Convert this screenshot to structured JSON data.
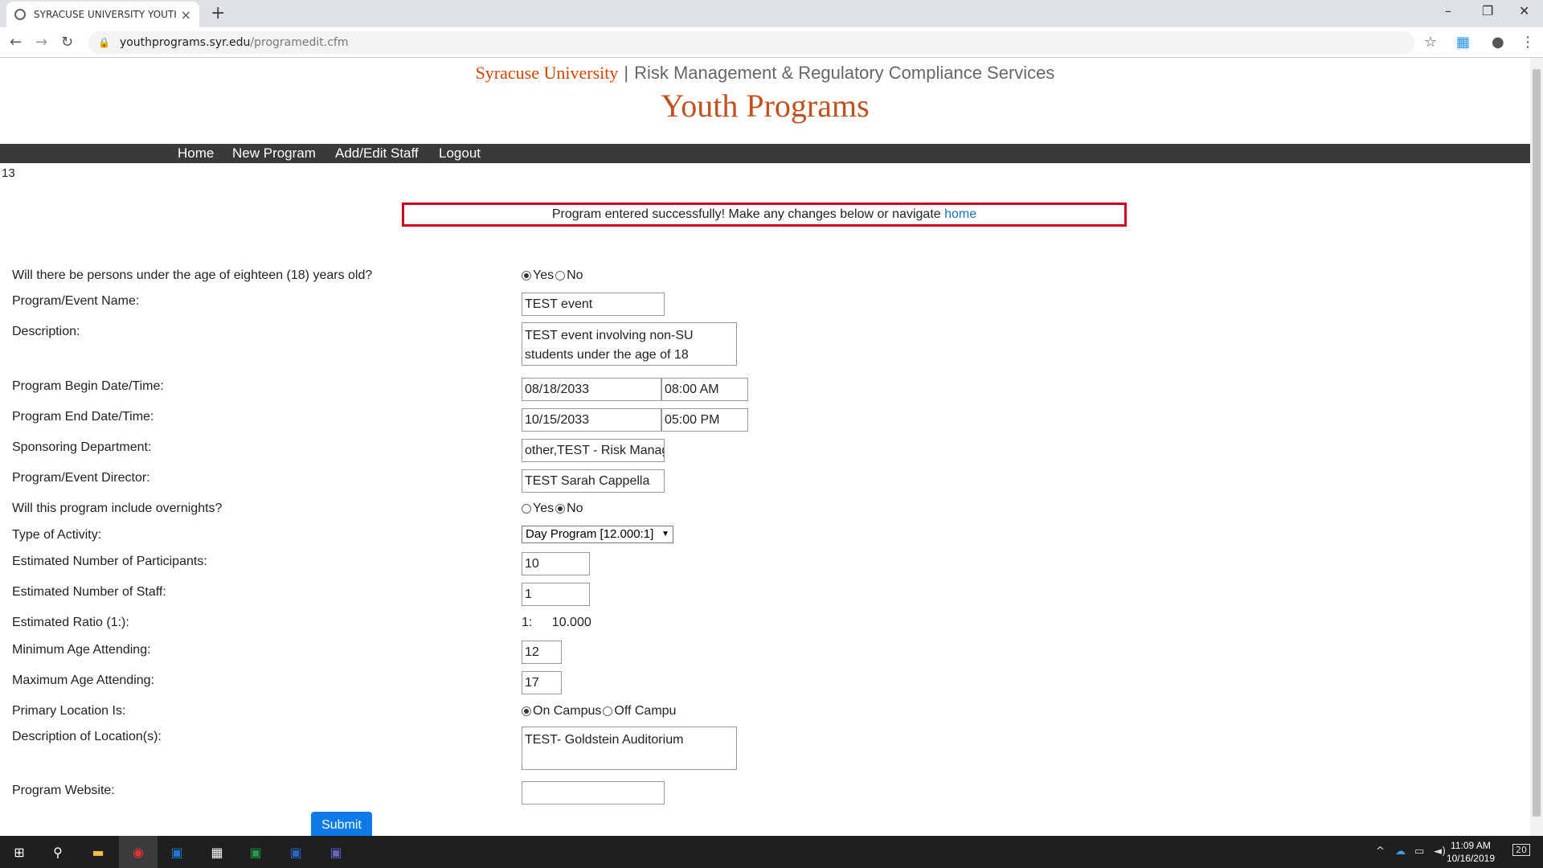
{
  "browser": {
    "tab_title": "SYRACUSE UNIVERSITY YOUTH P",
    "url_host": "youthprograms.syr.edu",
    "url_path": "/programedit.cfm"
  },
  "header": {
    "university": "Syracuse University",
    "separator": "|",
    "department": "Risk Management & Regulatory Compliance Services",
    "title": "Youth Programs"
  },
  "nav": {
    "home": "Home",
    "new_program": "New Program",
    "add_edit_staff": "Add/Edit Staff",
    "logout": "Logout"
  },
  "counter": "13",
  "alert": {
    "message": "Program entered successfully! Make any changes below or navigate ",
    "link": "home"
  },
  "form": {
    "under18": {
      "label": "Will there be persons under the age of eighteen (18) years old?",
      "yes": "Yes",
      "no": "No",
      "selected": "Yes"
    },
    "name": {
      "label": "Program/Event Name:",
      "value": "TEST event"
    },
    "description": {
      "label": "Description:",
      "value": "TEST event involving non-SU students under the age of 18"
    },
    "begin": {
      "label": "Program Begin Date/Time:",
      "date": "08/18/2033",
      "time": "08:00 AM"
    },
    "end": {
      "label": "Program End Date/Time:",
      "date": "10/15/2033",
      "time": "05:00 PM"
    },
    "sponsor": {
      "label": "Sponsoring Department:",
      "value": "other,TEST - Risk Manage"
    },
    "director": {
      "label": "Program/Event Director:",
      "value": "TEST Sarah Cappella"
    },
    "overnight": {
      "label": "Will this program include overnights?",
      "yes": "Yes",
      "no": "No",
      "selected": "No"
    },
    "activity": {
      "label": "Type of Activity:",
      "value": "Day Program [12.000:1]"
    },
    "participants": {
      "label": "Estimated Number of Participants:",
      "value": "10"
    },
    "staff": {
      "label": "Estimated Number of Staff:",
      "value": "1"
    },
    "ratio": {
      "label": "Estimated Ratio (1:):",
      "prefix": "1:",
      "value": "10.000"
    },
    "min_age": {
      "label": "Minimum Age Attending:",
      "value": "12"
    },
    "max_age": {
      "label": "Maximum Age Attending:",
      "value": "17"
    },
    "location": {
      "label": "Primary Location Is:",
      "on": "On Campus",
      "off": "Off Campu",
      "selected": "On Campus"
    },
    "location_desc": {
      "label": "Description of Location(s):",
      "value": "TEST- Goldstein Auditorium"
    },
    "website": {
      "label": "Program Website:",
      "value": ""
    },
    "submit": "Submit"
  },
  "taskbar": {
    "time": "11:09 AM",
    "date": "10/16/2019",
    "notifications": "20"
  }
}
